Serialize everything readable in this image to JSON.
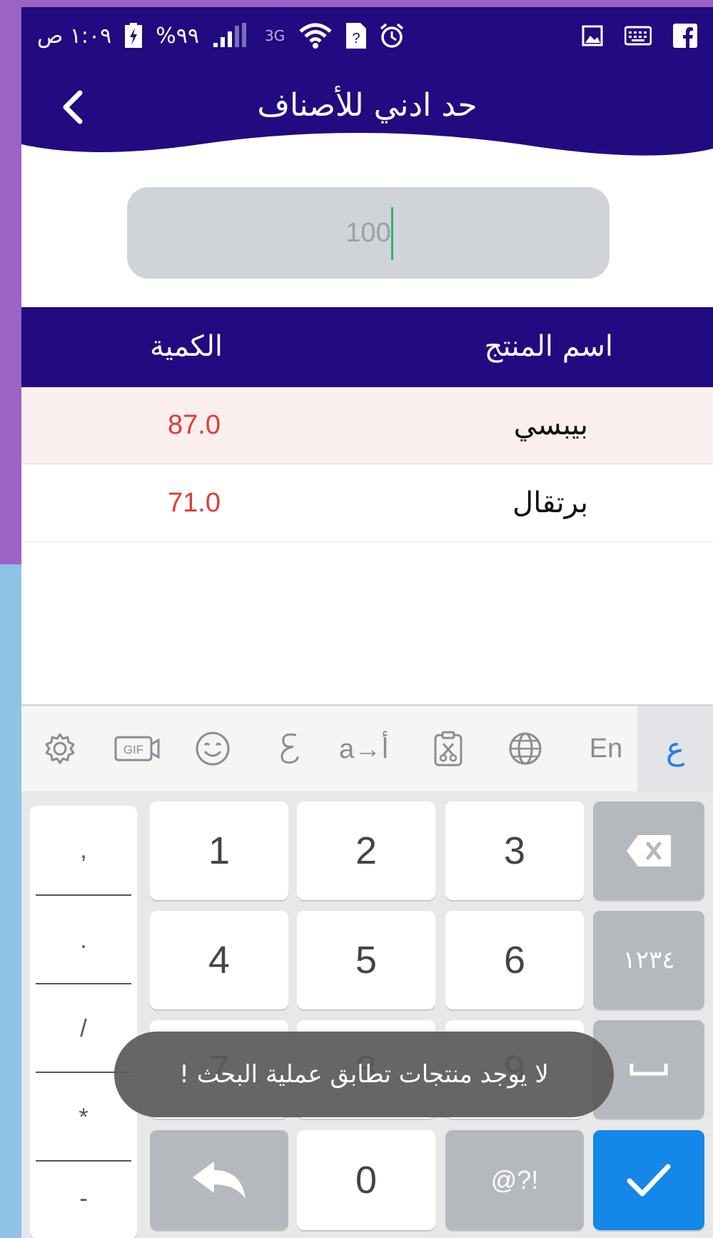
{
  "status_bar": {
    "time": "١:٠٩ ص",
    "battery": "%٩٩",
    "network": "3G",
    "icons": [
      "battery-charging-icon",
      "signal-icon",
      "wifi-icon",
      "sim-unknown-icon",
      "alarm-icon",
      "gallery-icon",
      "keyboard-icon",
      "facebook-icon"
    ]
  },
  "header": {
    "title": "حد ادني للأصناف",
    "back_icon": "chevron-left-icon",
    "color": "#220a80"
  },
  "search": {
    "value": "100",
    "placeholder": ""
  },
  "table": {
    "columns": {
      "name": "اسم المنتج",
      "quantity": "الكمية"
    },
    "rows": [
      {
        "name": "بيبسي",
        "quantity": "87.0"
      },
      {
        "name": "برتقال",
        "quantity": "71.0"
      }
    ],
    "quantity_color": "#e53935"
  },
  "keyboard": {
    "toolbar": {
      "items": [
        "settings-icon",
        "gif-icon",
        "emoji-icon",
        "sticker-icon",
        "translate-icon",
        "clipboard-icon",
        "globe-icon"
      ],
      "translate_label": "a→أ",
      "gif_label": "GIF",
      "lang_en": "En",
      "lang_ar": "ع"
    },
    "symbols": [
      ",",
      ".",
      "/",
      "*",
      "-"
    ],
    "digits": {
      "k1": "1",
      "k2": "2",
      "k3": "3",
      "k4": "4",
      "k5": "5",
      "k6": "6",
      "k7": "7",
      "k8": "8",
      "k9": "9",
      "k0": "0"
    },
    "arabic_digits_label": "١٢٣٤",
    "symbols_label": "@?!",
    "enter_color": "#1487e8"
  },
  "toast": {
    "message": "لا يوجد منتجات تطابق عملية البحث !"
  }
}
